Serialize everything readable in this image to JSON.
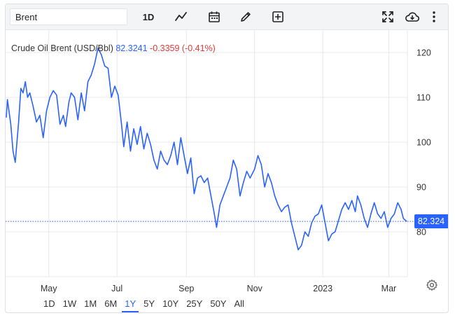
{
  "toolbar": {
    "search_value": "Brent",
    "interval_label": "1D",
    "icons": [
      "line-chart-icon",
      "calendar-icon",
      "pencil-icon",
      "plus-box-icon",
      "fullscreen-icon",
      "cloud-download-icon",
      "more-vertical-icon"
    ]
  },
  "legend": {
    "symbol": "Crude Oil Brent (USD/Bbl)",
    "last": "82.3241",
    "change": "-0.3359 (-0.41%)"
  },
  "price_label": "82.324",
  "colors": {
    "line": "#2962ff",
    "negative": "#e53935",
    "grid": "#e6e8eb"
  },
  "range_buttons": [
    "1D",
    "1W",
    "1M",
    "6M",
    "1Y",
    "5Y",
    "10Y",
    "25Y",
    "50Y",
    "All"
  ],
  "active_range": "1Y",
  "chart_data": {
    "type": "line",
    "x_tick_labels": [
      "May",
      "Jul",
      "Sep",
      "Nov",
      "2023",
      "Mar"
    ],
    "y_tick_labels": [
      "80",
      "90",
      "100",
      "110",
      "120"
    ],
    "ylim": [
      70,
      125
    ],
    "xlim": [
      "2022-03-24",
      "2023-03-17"
    ],
    "x_ticks": [
      "2022-05-01",
      "2022-07-01",
      "2022-09-01",
      "2022-11-01",
      "2023-01-01",
      "2023-03-01"
    ],
    "grid": true,
    "last_value": 82.324,
    "series": [
      {
        "values": [
          [
            "2022-03-24",
            105.5
          ],
          [
            "2022-03-25",
            109.5
          ],
          [
            "2022-03-28",
            104
          ],
          [
            "2022-03-30",
            98
          ],
          [
            "2022-04-01",
            95.5
          ],
          [
            "2022-04-04",
            104.5
          ],
          [
            "2022-04-06",
            112
          ],
          [
            "2022-04-08",
            111
          ],
          [
            "2022-04-10",
            113.5
          ],
          [
            "2022-04-12",
            110
          ],
          [
            "2022-04-14",
            111
          ],
          [
            "2022-04-17",
            108
          ],
          [
            "2022-04-20",
            104.5
          ],
          [
            "2022-04-23",
            106
          ],
          [
            "2022-04-26",
            101
          ],
          [
            "2022-04-29",
            107
          ],
          [
            "2022-05-02",
            110
          ],
          [
            "2022-05-05",
            111.5
          ],
          [
            "2022-05-08",
            110.5
          ],
          [
            "2022-05-11",
            104
          ],
          [
            "2022-05-14",
            106
          ],
          [
            "2022-05-16",
            103.5
          ],
          [
            "2022-05-19",
            109
          ],
          [
            "2022-05-21",
            111
          ],
          [
            "2022-05-24",
            110
          ],
          [
            "2022-05-27",
            105
          ],
          [
            "2022-05-30",
            111
          ],
          [
            "2022-06-02",
            107
          ],
          [
            "2022-06-05",
            113.5
          ],
          [
            "2022-06-08",
            115
          ],
          [
            "2022-06-11",
            117.5
          ],
          [
            "2022-06-14",
            121
          ],
          [
            "2022-06-17",
            119.5
          ],
          [
            "2022-06-20",
            117
          ],
          [
            "2022-06-23",
            116.5
          ],
          [
            "2022-06-26",
            110
          ],
          [
            "2022-06-29",
            112.5
          ],
          [
            "2022-07-02",
            110.5
          ],
          [
            "2022-07-05",
            104
          ],
          [
            "2022-07-07",
            99
          ],
          [
            "2022-07-10",
            104.5
          ],
          [
            "2022-07-13",
            98
          ],
          [
            "2022-07-16",
            103
          ],
          [
            "2022-07-19",
            99.5
          ],
          [
            "2022-07-22",
            103.5
          ],
          [
            "2022-07-25",
            98.5
          ],
          [
            "2022-07-28",
            102
          ],
          [
            "2022-07-31",
            99.5
          ],
          [
            "2022-08-03",
            96
          ],
          [
            "2022-08-06",
            94
          ],
          [
            "2022-08-09",
            98
          ],
          [
            "2022-08-12",
            96
          ],
          [
            "2022-08-15",
            95
          ],
          [
            "2022-08-18",
            97
          ],
          [
            "2022-08-21",
            100
          ],
          [
            "2022-08-24",
            95
          ],
          [
            "2022-08-27",
            101
          ],
          [
            "2022-08-30",
            97
          ],
          [
            "2022-09-02",
            93
          ],
          [
            "2022-09-05",
            96.5
          ],
          [
            "2022-09-08",
            88.5
          ],
          [
            "2022-09-11",
            92
          ],
          [
            "2022-09-14",
            92.5
          ],
          [
            "2022-09-17",
            91
          ],
          [
            "2022-09-20",
            92
          ],
          [
            "2022-09-23",
            88
          ],
          [
            "2022-09-26",
            84
          ],
          [
            "2022-09-28",
            81
          ],
          [
            "2022-10-01",
            86
          ],
          [
            "2022-10-04",
            88
          ],
          [
            "2022-10-07",
            90
          ],
          [
            "2022-10-10",
            92
          ],
          [
            "2022-10-13",
            96
          ],
          [
            "2022-10-16",
            94
          ],
          [
            "2022-10-19",
            88
          ],
          [
            "2022-10-22",
            91
          ],
          [
            "2022-10-25",
            93.5
          ],
          [
            "2022-10-28",
            92
          ],
          [
            "2022-11-01",
            94
          ],
          [
            "2022-11-04",
            97
          ],
          [
            "2022-11-07",
            95
          ],
          [
            "2022-11-10",
            90
          ],
          [
            "2022-11-13",
            93
          ],
          [
            "2022-11-16",
            91
          ],
          [
            "2022-11-19",
            88
          ],
          [
            "2022-11-22",
            86
          ],
          [
            "2022-11-25",
            84.5
          ],
          [
            "2022-11-28",
            85.5
          ],
          [
            "2022-12-01",
            86
          ],
          [
            "2022-12-04",
            82
          ],
          [
            "2022-12-07",
            79
          ],
          [
            "2022-12-10",
            76
          ],
          [
            "2022-12-13",
            77
          ],
          [
            "2022-12-16",
            80
          ],
          [
            "2022-12-19",
            79
          ],
          [
            "2022-12-22",
            82
          ],
          [
            "2022-12-25",
            83.5
          ],
          [
            "2022-12-28",
            84
          ],
          [
            "2022-12-31",
            86
          ],
          [
            "2023-01-03",
            82
          ],
          [
            "2023-01-06",
            78
          ],
          [
            "2023-01-09",
            79.5
          ],
          [
            "2023-01-12",
            80
          ],
          [
            "2023-01-15",
            82.5
          ],
          [
            "2023-01-18",
            85
          ],
          [
            "2023-01-21",
            86.5
          ],
          [
            "2023-01-24",
            85
          ],
          [
            "2023-01-27",
            87
          ],
          [
            "2023-01-30",
            84.5
          ],
          [
            "2023-02-01",
            88
          ],
          [
            "2023-02-04",
            86
          ],
          [
            "2023-02-07",
            83
          ],
          [
            "2023-02-10",
            81
          ],
          [
            "2023-02-13",
            84
          ],
          [
            "2023-02-16",
            86.5
          ],
          [
            "2023-02-19",
            84
          ],
          [
            "2023-02-22",
            83
          ],
          [
            "2023-02-25",
            84.5
          ],
          [
            "2023-02-28",
            81
          ],
          [
            "2023-03-03",
            83
          ],
          [
            "2023-03-06",
            84
          ],
          [
            "2023-03-09",
            86.5
          ],
          [
            "2023-03-12",
            85
          ],
          [
            "2023-03-14",
            83
          ],
          [
            "2023-03-17",
            82.324
          ]
        ]
      }
    ]
  }
}
